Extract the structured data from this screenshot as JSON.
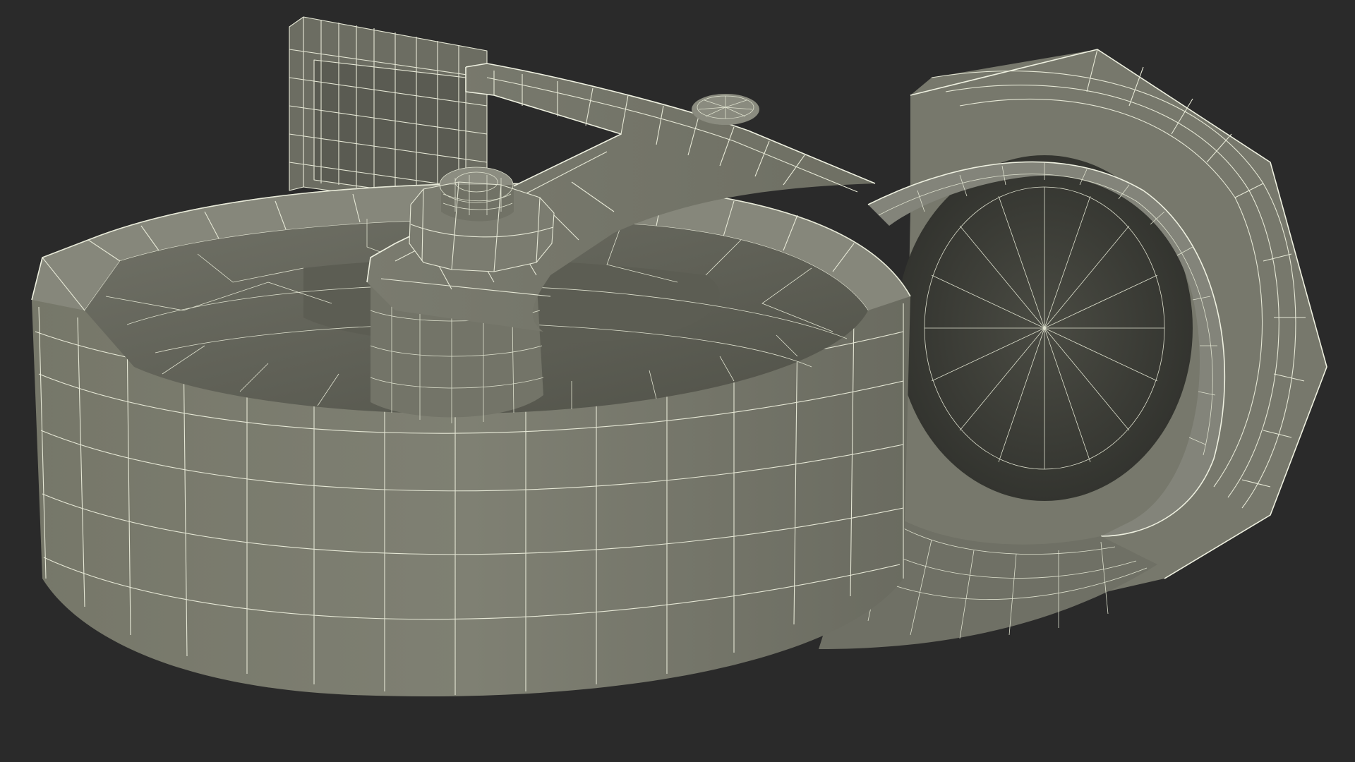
{
  "scene": {
    "subject": "caster-wheel-wireframe-model",
    "colors": {
      "background": "#2a2a2a",
      "surface_light": "#7d7e72",
      "surface_mid": "#6b6c61",
      "surface_dark": "#4b4c44",
      "surface_shadow": "#33342f",
      "wireframe": "#e6e8d6"
    }
  }
}
